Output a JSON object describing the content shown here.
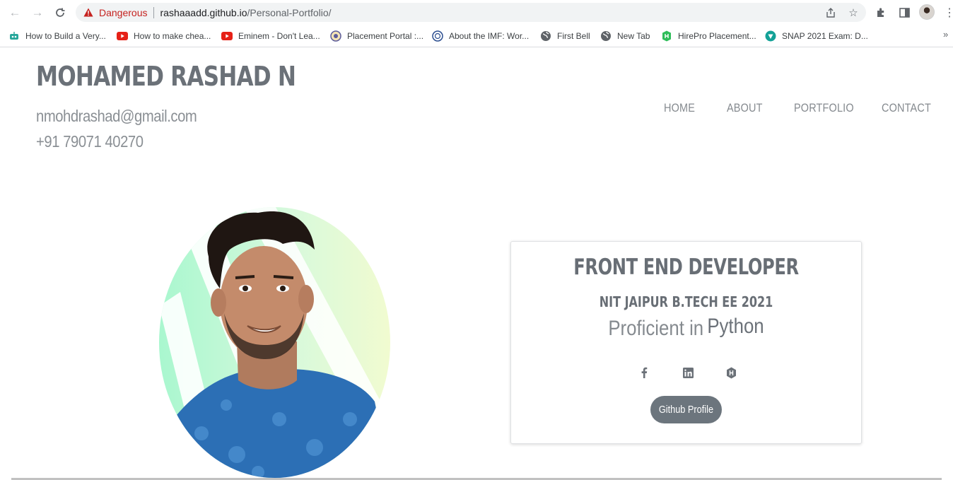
{
  "browser": {
    "security_label": "Dangerous",
    "url_host": "rashaaadd.github.io",
    "url_path": "/Personal-Portfolio/",
    "bookmarks": [
      {
        "label": "How to Build a Very...",
        "icon": "robot-icon"
      },
      {
        "label": "How to make chea...",
        "icon": "youtube-icon"
      },
      {
        "label": "Eminem - Don't Lea...",
        "icon": "youtube-icon"
      },
      {
        "label": "Placement Portal :...",
        "icon": "college-seal-icon"
      },
      {
        "label": "About the IMF: Wor...",
        "icon": "imf-seal-icon"
      },
      {
        "label": "First Bell",
        "icon": "globe-icon"
      },
      {
        "label": "New Tab",
        "icon": "globe-icon"
      },
      {
        "label": "HirePro Placement...",
        "icon": "hirepro-icon"
      },
      {
        "label": "SNAP 2021 Exam: D...",
        "icon": "snap-icon"
      }
    ],
    "more_bookmarks": "»"
  },
  "header": {
    "name": "MOHAMED RASHAD N",
    "email": "nmohdrashad@gmail.com",
    "phone": "+91 79071 40270"
  },
  "nav": {
    "items": [
      "HOME",
      "ABOUT",
      "PORTFOLIO",
      "CONTACT"
    ]
  },
  "profile_card": {
    "title": "FRONT END DEVELOPER",
    "subtitle": "NIT JAIPUR B.TECH EE 2021",
    "proficient_prefix": "Proficient in",
    "proficient_skill": "Python",
    "social_icons": [
      "facebook-icon",
      "linkedin-icon",
      "hackerrank-icon"
    ],
    "button_label": "Github Profile"
  },
  "colors": {
    "danger": "#c5221f",
    "heading": "#6b7178",
    "button": "#6c757d"
  }
}
